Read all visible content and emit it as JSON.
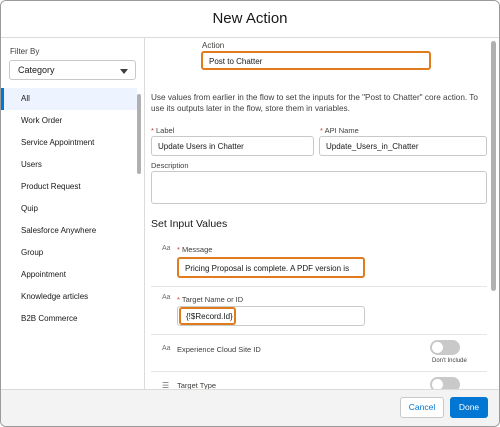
{
  "modal": {
    "title": "New Action"
  },
  "sidebar": {
    "filter_label": "Filter By",
    "filter_value": "Category",
    "items": [
      {
        "label": "All"
      },
      {
        "label": "Work Order"
      },
      {
        "label": "Service Appointment"
      },
      {
        "label": "Users"
      },
      {
        "label": "Product Request"
      },
      {
        "label": "Quip"
      },
      {
        "label": "Salesforce Anywhere"
      },
      {
        "label": "Group"
      },
      {
        "label": "Appointment"
      },
      {
        "label": "Knowledge articles"
      },
      {
        "label": "B2B Commerce"
      }
    ]
  },
  "form": {
    "action_label": "Action",
    "action_value": "Post to Chatter",
    "description_text": "Use values from earlier in the flow to set the inputs for the \"Post to Chatter\" core action. To use its outputs later in the flow, store them in variables.",
    "label_label": "Label",
    "label_value": "Update Users in Chatter",
    "api_name_label": "API Name",
    "api_name_value": "Update_Users_in_Chatter",
    "description_label": "Description",
    "required_mark": "*",
    "section_title": "Set Input Values",
    "text_icon": "Aa",
    "message_label": "Message",
    "message_value": "Pricing Proposal is complete. A PDF version is",
    "target_name_label": "Target Name or ID",
    "target_name_value": "{!$Record.Id}",
    "experience_label": "Experience Cloud Site ID",
    "toggle_caption": "Don't Include",
    "target_type_label": "Target Type"
  },
  "footer": {
    "cancel_label": "Cancel",
    "done_label": "Done"
  }
}
